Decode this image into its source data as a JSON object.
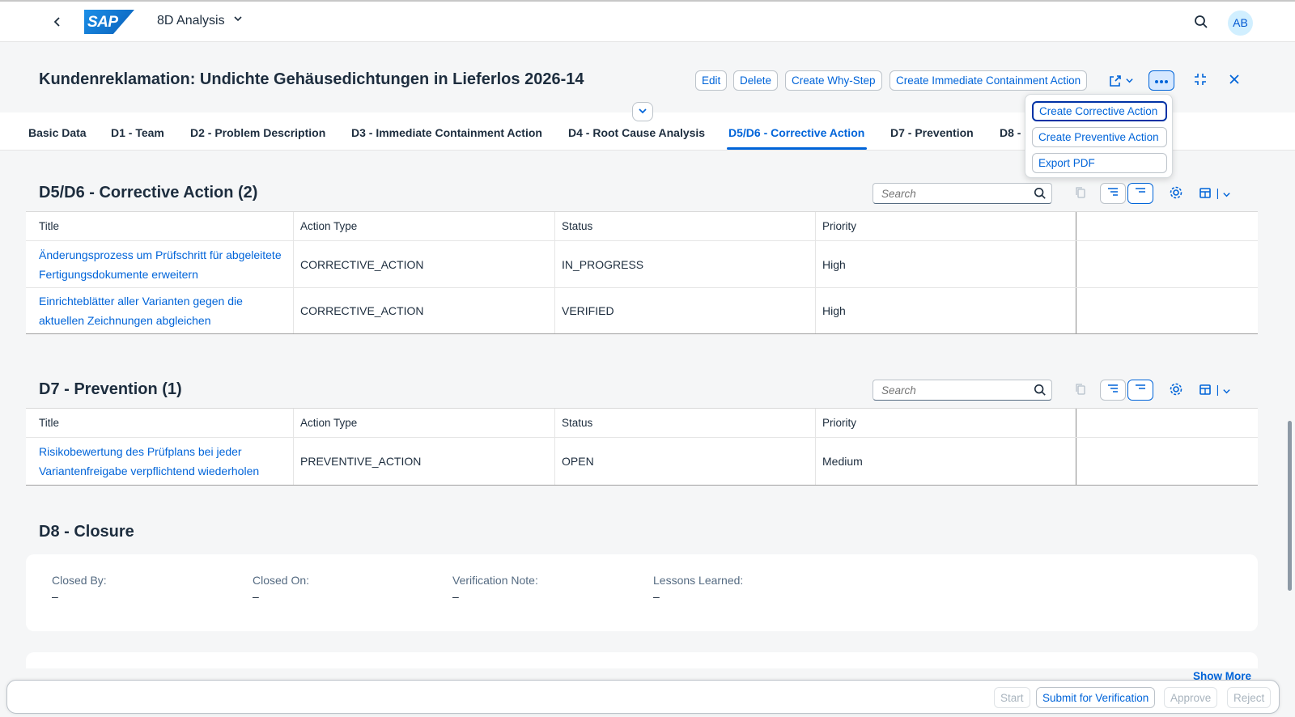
{
  "shell": {
    "app_title": "8D Analysis",
    "logo_text": "SAP",
    "avatar_initials": "AB"
  },
  "header": {
    "title": "Kundenreklamation: Undichte Gehäusedichtungen in Lieferlos 2026-14",
    "actions": {
      "edit": "Edit",
      "delete": "Delete",
      "create_why_step": "Create Why-Step",
      "create_immediate": "Create Immediate Containment Action"
    }
  },
  "overflow_menu": {
    "items": [
      "Create Corrective Action",
      "Create Preventive Action",
      "Export PDF"
    ]
  },
  "tabs": [
    "Basic Data",
    "D1 - Team",
    "D2 - Problem Description",
    "D3 - Immediate Containment Action",
    "D4 - Root Cause Analysis",
    "D5/D6 - Corrective Action",
    "D7 - Prevention",
    "D8 - C"
  ],
  "active_tab": "D5/D6 - Corrective Action",
  "columns": {
    "title": "Title",
    "action_type": "Action Type",
    "status": "Status",
    "priority": "Priority"
  },
  "search_placeholder": "Search",
  "corrective": {
    "title": "D5/D6 - Corrective Action (2)",
    "rows": [
      {
        "title_line1": "Änderungsprozess um Prüfschritt für abgeleitete",
        "title_line2": "Fertigungsdokumente erweitern",
        "action_type": "CORRECTIVE_ACTION",
        "status": "IN_PROGRESS",
        "priority": "High"
      },
      {
        "title_line1": "Einrichteblätter aller Varianten gegen die",
        "title_line2": "aktuellen Zeichnungen abgleichen",
        "action_type": "CORRECTIVE_ACTION",
        "status": "VERIFIED",
        "priority": "High"
      }
    ]
  },
  "prevention": {
    "title": "D7 - Prevention (1)",
    "rows": [
      {
        "title_line1": "Risikobewertung des Prüfplans bei jeder",
        "title_line2": "Variantenfreigabe verpflichtend wiederholen",
        "action_type": "PREVENTIVE_ACTION",
        "status": "OPEN",
        "priority": "Medium"
      }
    ]
  },
  "closure": {
    "title": "D8 - Closure",
    "fields": [
      {
        "label": "Closed By:",
        "value": "–"
      },
      {
        "label": "Closed On:",
        "value": "–"
      },
      {
        "label": "Verification Note:",
        "value": "–"
      },
      {
        "label": "Lessons Learned:",
        "value": "–"
      }
    ]
  },
  "show_more": "Show More",
  "footer": {
    "start": "Start",
    "submit": "Submit for Verification",
    "approve": "Approve",
    "reject": "Reject"
  },
  "colors": {
    "accent": "#0064d9",
    "text": "#1d2d3e",
    "background": "#f5f6f7"
  }
}
